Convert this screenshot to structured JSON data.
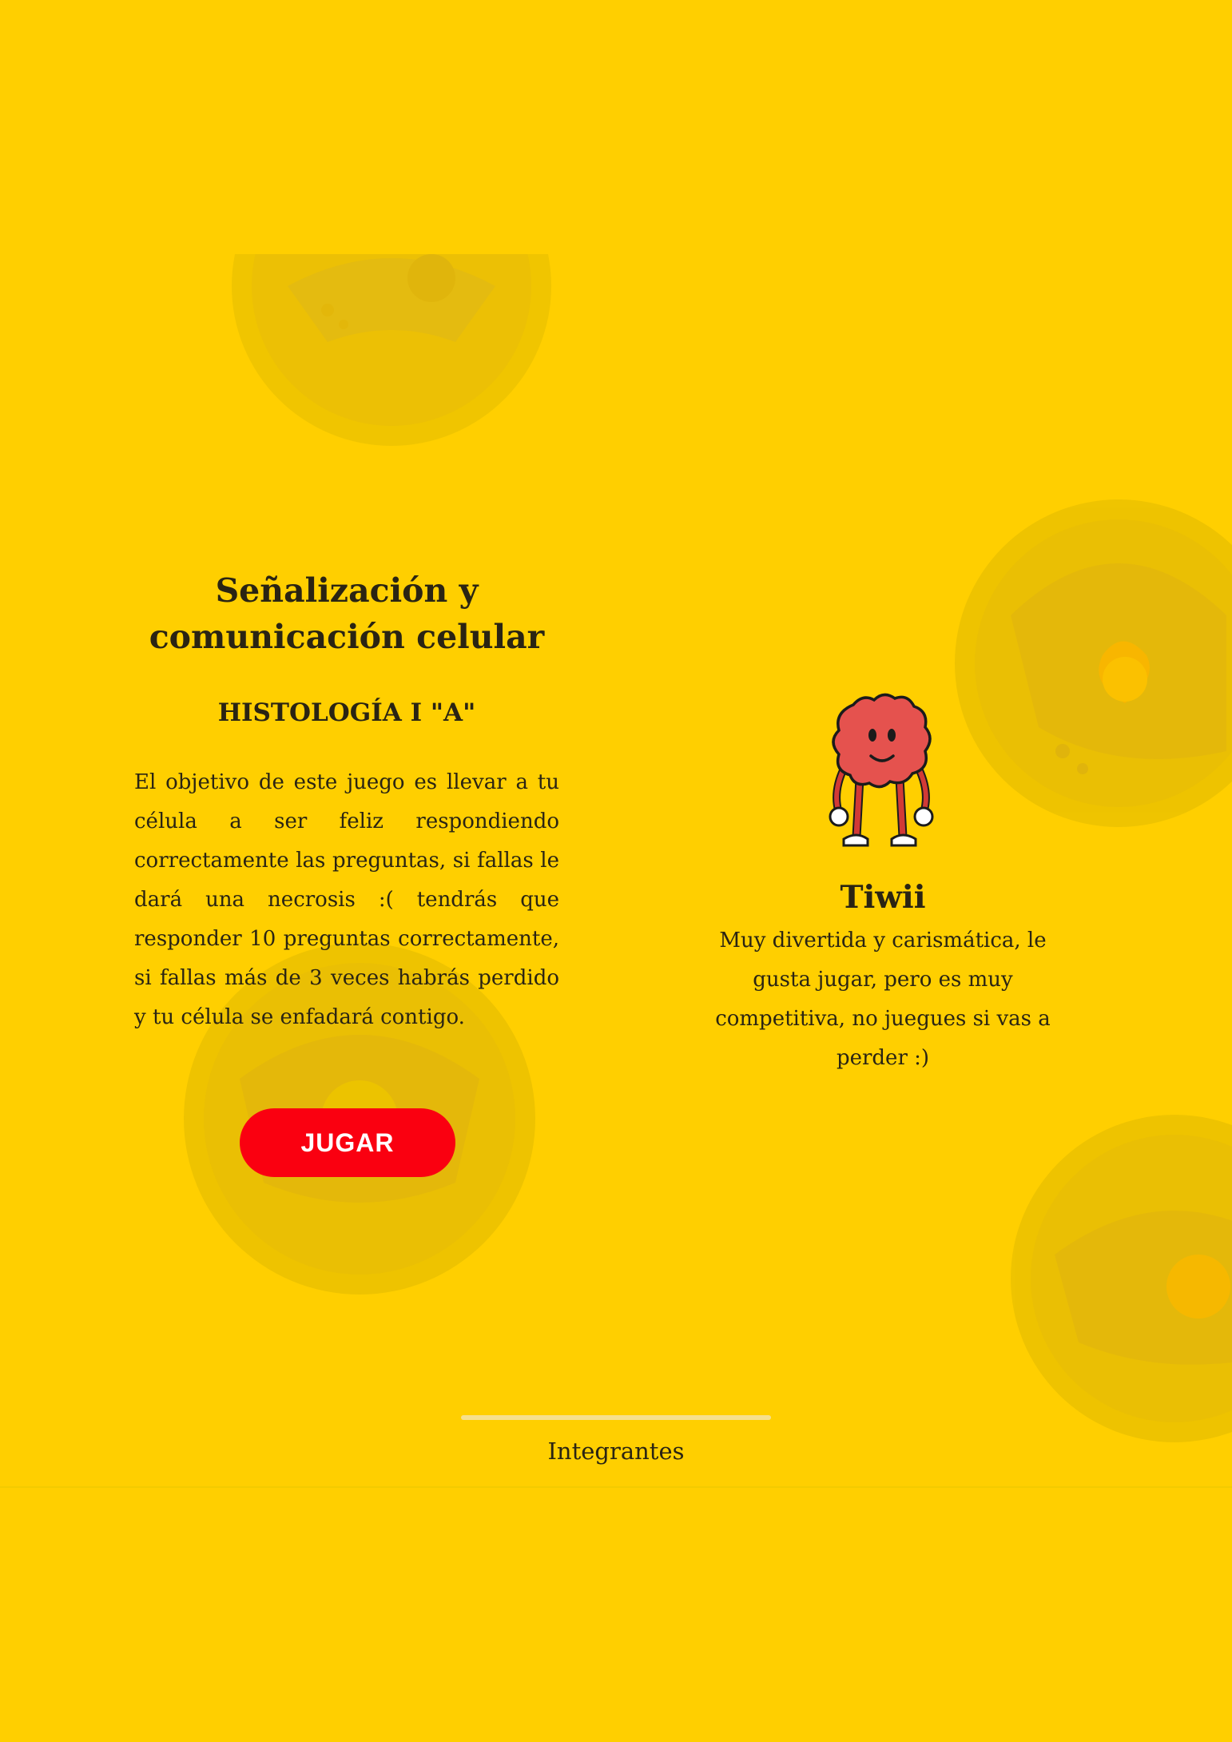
{
  "colors": {
    "background": "#FFCF00",
    "button": "#FA0010",
    "button_text": "#FFFFFF",
    "text": "#2A2413",
    "mascot_body": "#E5524E"
  },
  "intro": {
    "title": "Señalización y comunicación celular",
    "subtitle": "HISTOLOGÍA I \"A\"",
    "description": "El objetivo de este juego es llevar a tu célula a ser feliz respondiendo correctamente las preguntas, si fallas le dará una necrosis :( tendrás que responder 10 preguntas correctamente, si fallas más de 3 veces habrás perdido y tu célula se enfadará contigo.",
    "play_button": "JUGAR"
  },
  "character": {
    "name": "Tiwii",
    "description": "Muy divertida y carismática, le gusta jugar, pero es muy competitiva, no juegues si vas a perder :)",
    "image_icon": "cell-mascot-icon"
  },
  "footer": {
    "link": "Integrantes"
  }
}
